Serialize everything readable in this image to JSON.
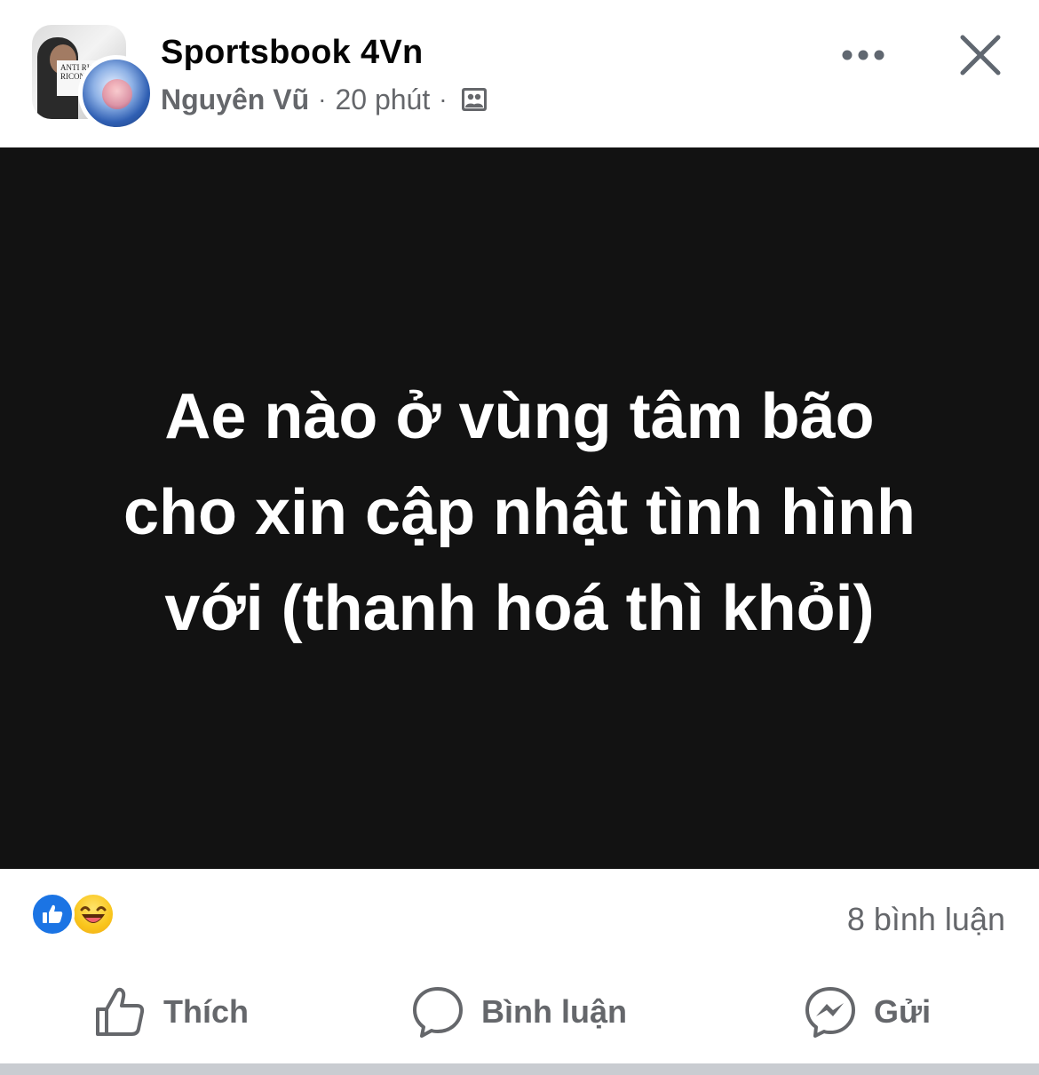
{
  "header": {
    "group_name": "Sportsbook 4Vn",
    "author": "Nguyên Vũ",
    "time": "20 phút",
    "separator": "·",
    "group_avatar_sign_text": "ANTI RIG RICON",
    "audience_icon": "group-audience-icon",
    "more_icon": "more-options-icon",
    "close_icon": "close-icon"
  },
  "post": {
    "text": "Ae nào ở vùng tâm bão cho xin cập nhật tình hình với (thanh hoá thì khỏi)",
    "background_color": "#121212",
    "text_color": "#ffffff"
  },
  "reactions": {
    "types": [
      "like",
      "haha"
    ],
    "comments_label": "8 bình luận"
  },
  "actions": {
    "like_label": "Thích",
    "comment_label": "Bình luận",
    "share_label": "Gửi"
  },
  "colors": {
    "accent_blue": "#1b74e4",
    "secondary_text": "#65676b",
    "primary_text": "#050505"
  }
}
